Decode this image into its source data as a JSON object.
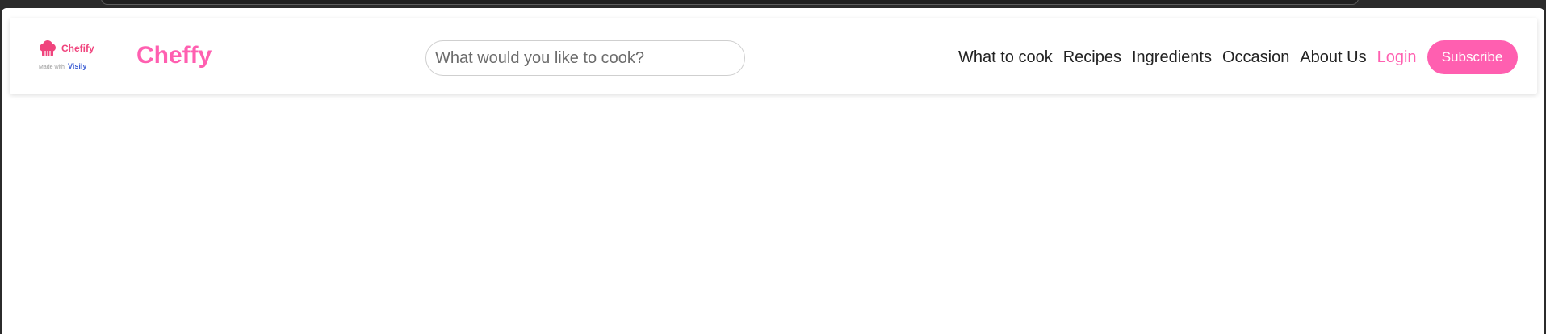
{
  "badge": {
    "name": "Chefify",
    "made_with": "Made with",
    "made_with_brand": "Visily"
  },
  "header": {
    "brand": "Cheffy"
  },
  "search": {
    "placeholder": "What would you like to cook?"
  },
  "nav": {
    "items": [
      {
        "label": "What to cook"
      },
      {
        "label": "Recipes"
      },
      {
        "label": "Ingredients"
      },
      {
        "label": "Occasion"
      },
      {
        "label": "About Us"
      }
    ],
    "login": "Login",
    "subscribe": "Subscribe"
  },
  "colors": {
    "accent": "#ff5fb0",
    "badge_pink": "#f0447d",
    "visily_blue": "#3e5fd4",
    "text": "#222222"
  }
}
